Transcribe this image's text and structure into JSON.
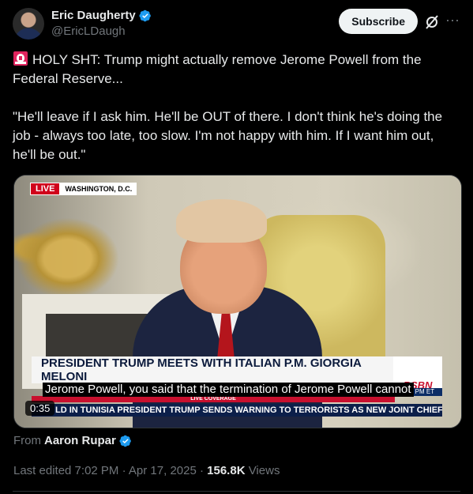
{
  "author": {
    "display_name": "Eric Daugherty",
    "handle": "@EricLDaugh"
  },
  "actions": {
    "subscribe_label": "Subscribe",
    "grok_icon": "grok-icon",
    "more_icon": "more-icon"
  },
  "tweet": {
    "lines": [
      "HOLY SHT: Trump might actually remove Jerome Powell from the Federal Reserve...",
      "",
      "\"He'll leave if I ask him. He'll be OUT of there. I don't think he's doing the job - always too late, too slow. I'm not happy with him. If I want him out, he'll be out.\""
    ],
    "emoji": "rotating-light-icon"
  },
  "media": {
    "live_label": "LIVE",
    "location": "WASHINGTON, D.C.",
    "headline": "PRESIDENT TRUMP MEETS WITH ITALIAN P.M. GIORGIA MELONI",
    "caption": "Jerome Powell, you said that the termination of Jerome Powell cannot",
    "network_logo": "RSBN",
    "network_time": "1:48 PM ET",
    "red_bar_text": "LIVE COVERAGE",
    "ticker": "LD IN TUNISIA     PRESIDENT TRUMP SENDS WARNING TO TERRORISTS AS NEW JOINT CHIEF",
    "duration": "0:35"
  },
  "from": {
    "prefix": "From",
    "name": "Aaron Rupar"
  },
  "meta": {
    "edited": "Last edited 7:02 PM · Apr 17, 2025 · ",
    "views_count": "156.8K",
    "views_label": " Views"
  },
  "colors": {
    "background": "#000000",
    "text": "#e7e9ea",
    "muted": "#71767b",
    "verified": "#1d9bf0"
  }
}
